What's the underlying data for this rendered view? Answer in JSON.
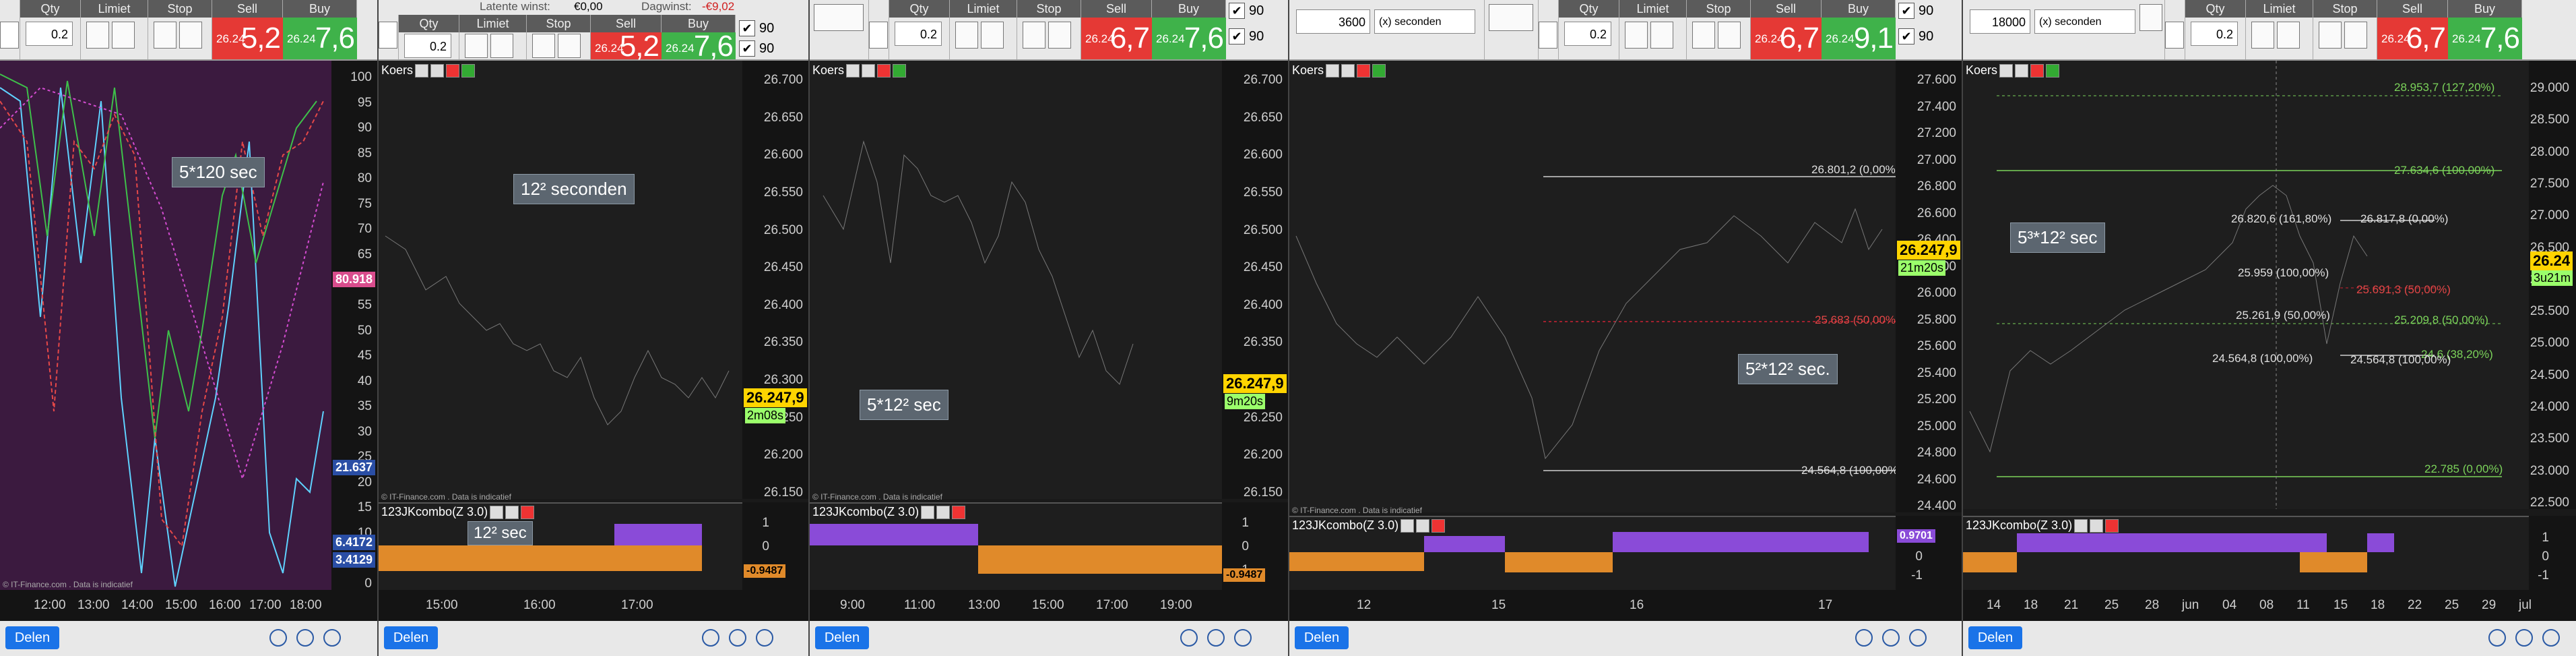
{
  "toolbar": {
    "qty_header": "Qty",
    "limit_header": "Limiet",
    "stop_header": "Stop",
    "sell_header": "Sell",
    "buy_header": "Buy",
    "qty_value": "0.2",
    "sell_small": "26.24",
    "sell_big_1": "5,2",
    "buy_small": "26.24",
    "buy_big_1": "7,6",
    "sell_big_2": "6,7",
    "buy_big_2": "9,1",
    "chk_value": "90"
  },
  "panel2_header": {
    "latent_label": "Latente winst:",
    "latent_value": "€0,00",
    "day_label": "Dagwinst:",
    "day_value": "-€9,02"
  },
  "interval_selectors": {
    "p4_value": "3600",
    "p4_unit": "(x) seconden",
    "p5_value": "18000",
    "p5_unit": "(x) seconden"
  },
  "common": {
    "koers_label": "Koers",
    "indicator_label": "123JKcombo(Z 3.0)",
    "copyright": "© IT-Finance.com . Data is indicatief",
    "delen": "Delen"
  },
  "panel1": {
    "label": "5*120 sec",
    "yticks": [
      "100",
      "95",
      "90",
      "85",
      "80",
      "75",
      "70",
      "65",
      "60",
      "55",
      "50",
      "45",
      "40",
      "35",
      "30",
      "25",
      "20",
      "15",
      "10",
      "5",
      "0"
    ],
    "ylabels_colored": [
      "100",
      "90",
      "80.918",
      "21.637",
      "6.4172",
      "3.4129"
    ],
    "xticks": [
      "12:00",
      "13:00",
      "14:00",
      "15:00",
      "16:00",
      "17:00",
      "18:00"
    ]
  },
  "panel2": {
    "label": "12² seconden",
    "label2": "12² sec",
    "yticks": [
      "26.700",
      "26.650",
      "26.600",
      "26.550",
      "26.500",
      "26.450",
      "26.400",
      "26.350",
      "26.300",
      "26.250",
      "26.200",
      "26.150"
    ],
    "price": "26.247,9",
    "countdown": "2m08s",
    "ind_ticks": [
      "1",
      "0",
      "-1"
    ],
    "ind_value": "-0.9487",
    "xticks": [
      "15:00",
      "16:00",
      "17:00"
    ]
  },
  "panel3": {
    "label": "5*12² sec",
    "yticks": [
      "26.700",
      "26.650",
      "26.600",
      "26.550",
      "26.500",
      "26.450",
      "26.400",
      "26.350",
      "26.300",
      "26.250",
      "26.200",
      "26.150"
    ],
    "price": "26.247,9",
    "countdown": "9m20s",
    "ind_ticks": [
      "1",
      "0",
      "-1"
    ],
    "ind_value": "-0.9487",
    "xticks": [
      "9:00",
      "11:00",
      "13:00",
      "15:00",
      "17:00",
      "19:00"
    ]
  },
  "panel4": {
    "label": "5²*12² sec.",
    "yticks": [
      "27.600",
      "27.400",
      "27.200",
      "27.000",
      "26.800",
      "26.600",
      "26.400",
      "26.200",
      "26.000",
      "25.800",
      "25.600",
      "25.400",
      "25.200",
      "25.000",
      "24.800",
      "24.600",
      "24.400"
    ],
    "price": "26.247,9",
    "countdown": "21m20s",
    "level_top": "26.801,2 (0,00%)",
    "level_mid": "25.683 (50,00%)",
    "level_bot": "24.564,8 (100,00%)",
    "ind_ticks": [
      "1",
      "0",
      "-1"
    ],
    "ind_value": "0.9701",
    "xticks": [
      "12",
      "15",
      "16",
      "17"
    ]
  },
  "panel5": {
    "label": "5³*12² sec",
    "yticks": [
      "29.000",
      "28.500",
      "28.000",
      "27.500",
      "27.000",
      "26.500",
      "26.000",
      "25.500",
      "25.000",
      "24.500",
      "24.000",
      "23.500",
      "23.000",
      "22.500"
    ],
    "price": "26.24",
    "countdown": "3u21m",
    "levels": {
      "l1": "28.953,7 (127,20%)",
      "l2": "27.634,6 (100,00%)",
      "l3": "26.820,6 (161,80%)",
      "l4": "26.817,8 (0,00%)",
      "l5": "25.959 (100,00%)",
      "l6": "25.691,3 (50,00%)",
      "l7": "25.261,9 (50,00%)",
      "l8": "25.209,8 (50,00%)",
      "l9": "24.564,8 (100,00%)",
      "l10": "24.564,8 (100,00%)",
      "l11": "24.6 (38,20%)",
      "l12": "22.785 (0,00%)"
    },
    "ind_ticks": [
      "1",
      "0",
      "-1"
    ],
    "xticks": [
      "14",
      "18",
      "21",
      "25",
      "28",
      "jun",
      "04",
      "08",
      "11",
      "15",
      "18",
      "22",
      "25",
      "29",
      "jul"
    ]
  }
}
